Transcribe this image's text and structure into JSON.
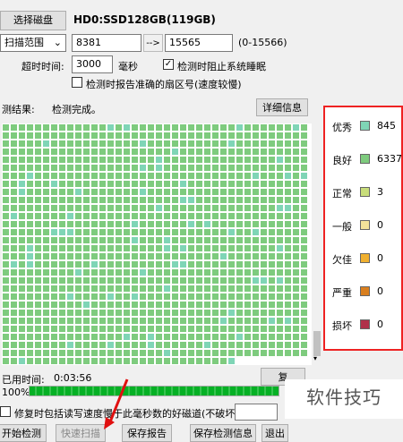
{
  "top": {
    "select_disk_button": "选择磁盘",
    "disk_name": "HD0:SSD128GB(119GB)",
    "scan_range_select": "扫描范围",
    "range_start": "8381",
    "range_arrow_button": "-->",
    "range_end": "15565",
    "range_hint": "(0-15566)",
    "timeout_label": "超时时间:",
    "timeout_value": "3000",
    "timeout_unit": "毫秒",
    "stop_on_timeout_label": "检测时阻止系统睡眠",
    "report_sector_label": "检测时报告准确的扇区号(速度较慢)"
  },
  "results": {
    "label": "测结果:",
    "status": "检测完成。",
    "details_button": "详细信息"
  },
  "legend": [
    {
      "label": "优秀",
      "color": "#7fd5b6",
      "count": "845"
    },
    {
      "label": "良好",
      "color": "#7ecb7e",
      "count": "6337"
    },
    {
      "label": "正常",
      "color": "#c8dd7a",
      "count": "3"
    },
    {
      "label": "一般",
      "color": "#f3e29a",
      "count": "0"
    },
    {
      "label": "欠佳",
      "color": "#f0b030",
      "count": "0"
    },
    {
      "label": "严重",
      "color": "#d97f1f",
      "count": "0"
    },
    {
      "label": "损坏",
      "color": "#b0304a",
      "count": "0"
    }
  ],
  "bottom": {
    "elapsed_label": "已用时间:",
    "elapsed_value": "0:03:56",
    "right_button": "复",
    "progress_label": "100%",
    "progress": 1.0,
    "repair_label": "修复时包括读写速度慢于此毫秒数的好磁道(不破坏数据):",
    "buttons": [
      "开始检测",
      "快速扫描",
      "保存报告",
      "保存检测信息",
      "退出"
    ]
  },
  "watermark": "软件技巧",
  "colors": {
    "grid_green": "#7ecb7e",
    "grid_teal": "#7fd5b6",
    "frame_red": "#e22"
  }
}
